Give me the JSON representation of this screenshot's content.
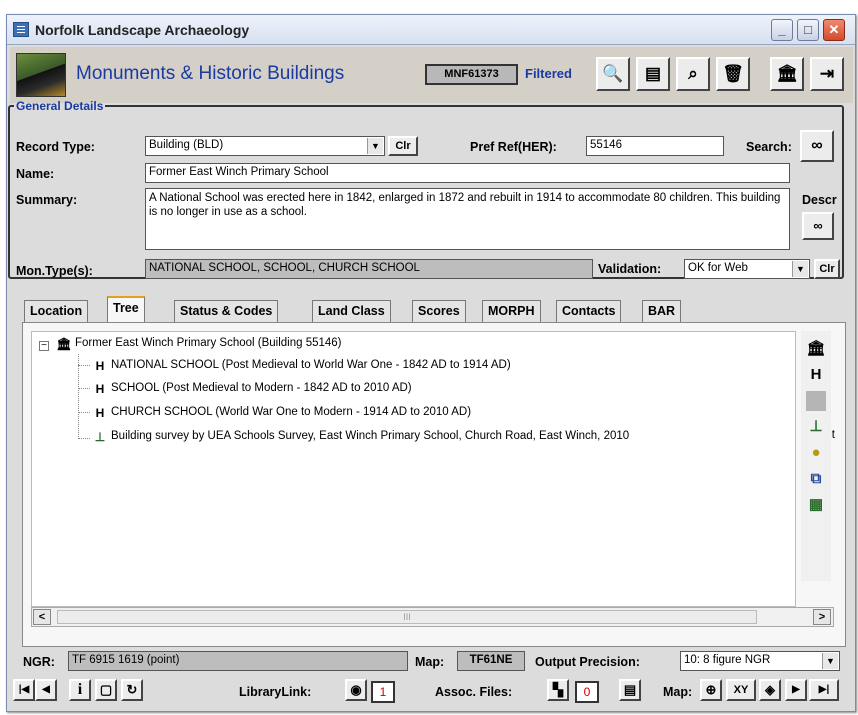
{
  "window": {
    "title": "Norfolk Landscape Archaeology",
    "minimize": "_",
    "maximize": "□",
    "close": "✕"
  },
  "header": {
    "app_title": "Monuments & Historic Buildings",
    "record_id": "MNF61373",
    "filtered": "Filtered"
  },
  "toolbar_icons": [
    "preview-icon",
    "report-icon",
    "find-icon",
    "delete-icon",
    "building-icon",
    "exit-icon"
  ],
  "general": {
    "legend": "General Details",
    "record_type_label": "Record Type:",
    "record_type_value": "Building (BLD)",
    "clr": "Clr",
    "pref_ref_label": "Pref Ref(HER):",
    "pref_ref_value": "55146",
    "search_label": "Search:",
    "name_label": "Name:",
    "name_value": "Former East Winch Primary School",
    "summary_label": "Summary:",
    "summary_value": "A National School was erected here in 1842, enlarged in 1872 and rebuilt in 1914 to accommodate 80 children. This building is no longer in use as a school.",
    "descr_label": "Descr",
    "mon_types_label": "Mon.Type(s):",
    "mon_types_value": "NATIONAL SCHOOL, SCHOOL, CHURCH SCHOOL",
    "validation_label": "Validation:",
    "validation_value": "OK for Web",
    "clr2": "Clr"
  },
  "tabs": [
    "Location",
    "Tree",
    "Status & Codes",
    "Land Class",
    "Scores",
    "MORPH",
    "Contacts",
    "BAR"
  ],
  "active_tab": "Tree",
  "tree": {
    "root": "Former East Winch Primary School (Building 55146)",
    "children": [
      "NATIONAL SCHOOL (Post Medieval to World War One - 1842 AD to 1914 AD)",
      "SCHOOL (Post Medieval to Modern - 1842 AD to 2010 AD)",
      "CHURCH SCHOOL (World War One to Modern - 1914 AD to 2010 AD)",
      "Building survey by UEA Schools Survey, East Winch Primary School, Church Road, East Winch, 2010"
    ],
    "overflow_text": "ent"
  },
  "side_icons": [
    "building-icon",
    "monument-type-icon",
    "blank-icon",
    "event-icon",
    "coins-icon",
    "copy-icon",
    "map-layer-icon"
  ],
  "scroll": {
    "left": "<",
    "right": ">",
    "grip": "III"
  },
  "ngr": {
    "label": "NGR:",
    "value": "TF 6915 1619  (point)",
    "map_label": "Map:",
    "map_value": "TF61NE",
    "precision_label": "Output Precision:",
    "precision_value": "10:  8 figure NGR"
  },
  "bottom": {
    "first": "|◀",
    "prev": "◀",
    "info": "i",
    "doc": "▢",
    "refresh": "↻",
    "library_label": "LibraryLink:",
    "library_count": "1",
    "assoc_label": "Assoc. Files:",
    "assoc_count": "0",
    "map_label": "Map:",
    "xy": "XY",
    "next": "▶",
    "last": "▶|"
  }
}
